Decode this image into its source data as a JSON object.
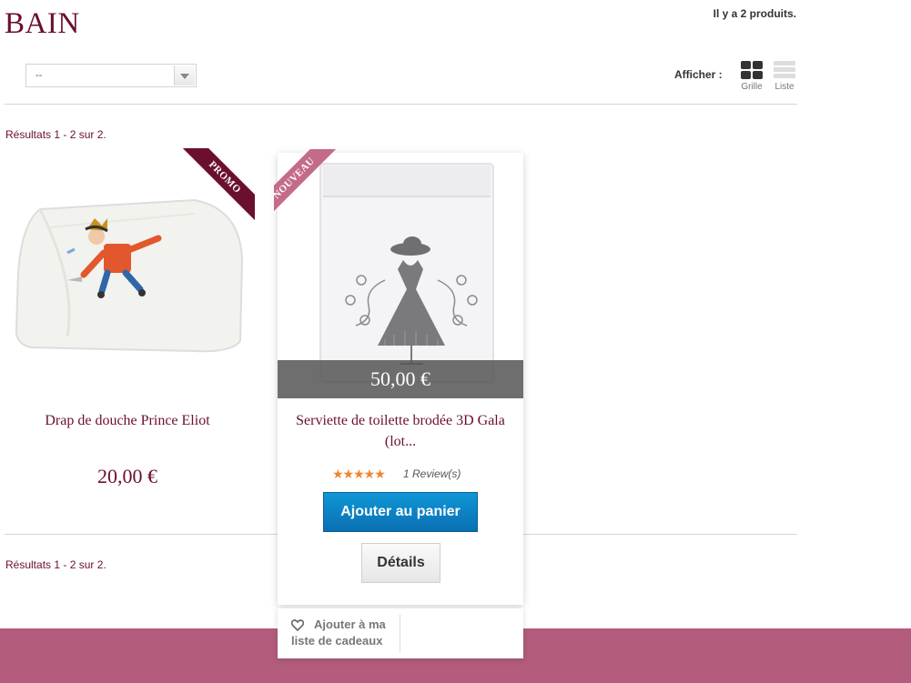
{
  "category": {
    "title": "BAIN",
    "product_count": "Il y a 2 produits."
  },
  "sort": {
    "selected": "--"
  },
  "view": {
    "label": "Afficher :",
    "grid_label": "Grille",
    "list_label": "Liste"
  },
  "results": {
    "top": "Résultats 1 - 2 sur 2.",
    "bottom": "Résultats 1 - 2 sur 2."
  },
  "products": [
    {
      "name": "Drap de douche Prince Eliot",
      "price": "20,00 €",
      "ribbon": "PROMO"
    },
    {
      "name": "Serviette de toilette brodée 3D Gala (lot...",
      "price": "50,00 €",
      "ribbon": "NOUVEAU",
      "rating": 5,
      "stars": "★★★★★",
      "reviews": "1 Review(s)",
      "add_to_cart": "Ajouter au panier",
      "details": "Détails",
      "wishlist": "Ajouter à ma liste de cadeaux"
    }
  ],
  "colors": {
    "brand": "#6b0f2f",
    "footer": "#b35c7d",
    "cart_button": "#0a7fc4",
    "stars": "#f1852f"
  }
}
